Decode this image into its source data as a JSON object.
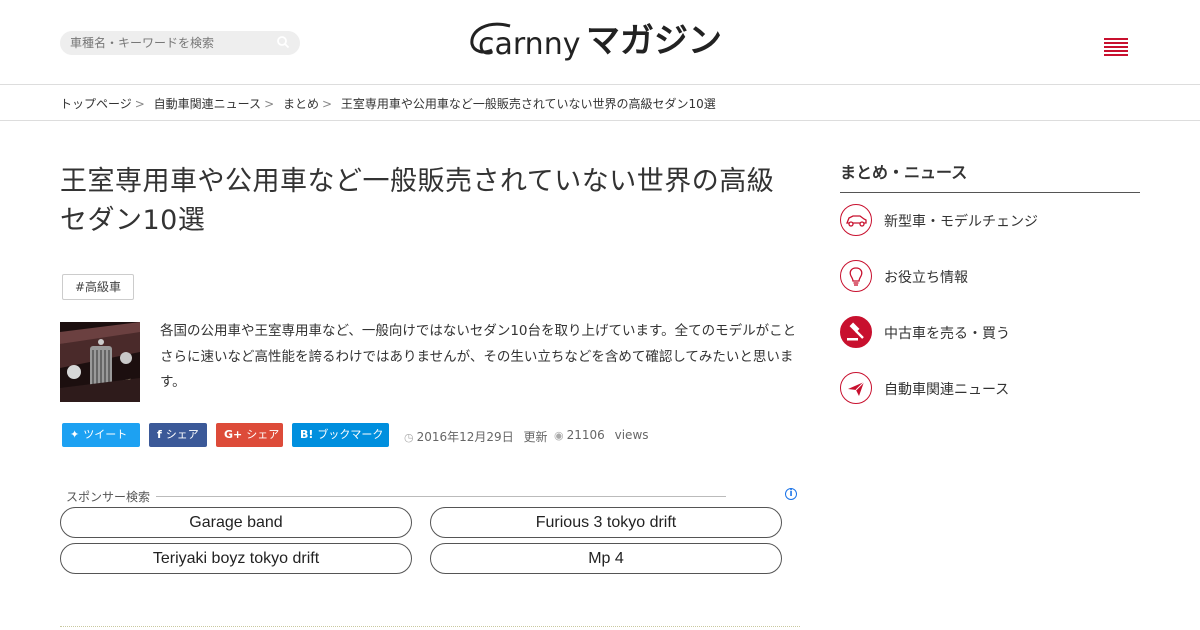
{
  "header": {
    "search": {
      "placeholder": "車種名・キーワードを検索"
    },
    "logo": {
      "wordmark": "carnny",
      "suffix": "マガジン"
    }
  },
  "breadcrumb": {
    "items": [
      "トップページ",
      "自動車関連ニュース",
      "まとめ"
    ],
    "separator": ">",
    "current": "王室専用車や公用車など一般販売されていない世界の高級セダン10選"
  },
  "article": {
    "title": "王室専用車や公用車など一般販売されていない世界の高級セダン10選",
    "tag": "#高級車",
    "lead": "各国の公用車や王室専用車など、一般向けではないセダン10台を取り上げています。全てのモデルがことさらに速いなど高性能を誇るわけではありませんが、その生い立ちなどを含めて確認してみたいと思います。",
    "share": {
      "tweet": "ツイート",
      "facebook": "シェア",
      "googleplus": "シェア",
      "hatena": "ブックマーク"
    },
    "date": "2016年12月29日",
    "updated_label": "更新",
    "views_count": "21106",
    "views_label": "views"
  },
  "sponsor": {
    "label": "スポンサー検索",
    "links": [
      "Garage band",
      "Furious 3 tokyo drift",
      "Teriyaki boyz tokyo drift",
      "Mp 4"
    ]
  },
  "sidebar": {
    "title": "まとめ・ニュース",
    "items": [
      {
        "label": "新型車・モデルチェンジ",
        "icon": "car-icon"
      },
      {
        "label": "お役立ち情報",
        "icon": "lightbulb-icon"
      },
      {
        "label": "中古車を売る・買う",
        "icon": "auction-hammer-icon"
      },
      {
        "label": "自動車関連ニュース",
        "icon": "paper-plane-icon"
      }
    ]
  },
  "colors": {
    "brand_red": "#c8102e",
    "twitter": "#1da1f2",
    "facebook": "#3b5998",
    "googleplus": "#dd4b39",
    "hatena": "#008fde"
  }
}
